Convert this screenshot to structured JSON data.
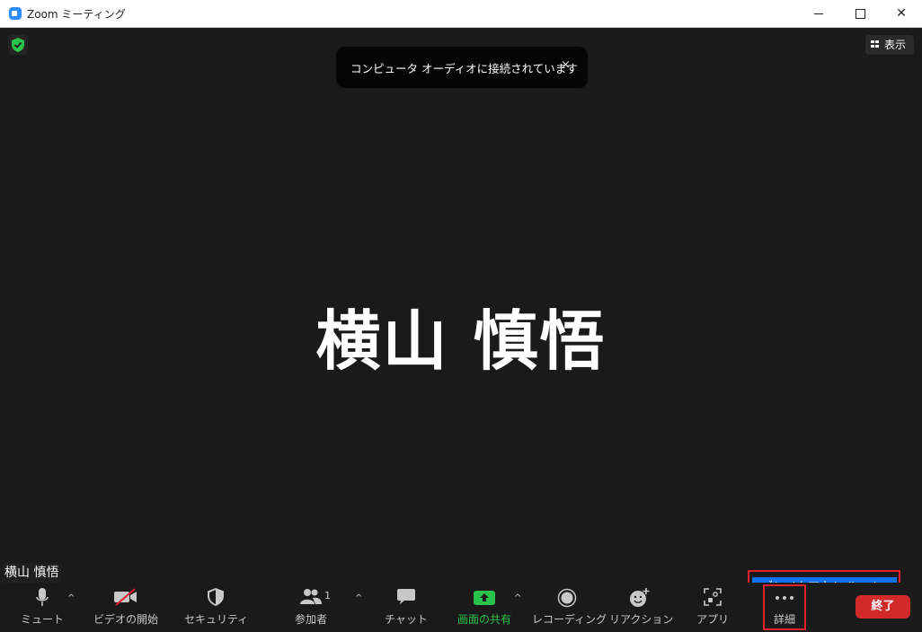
{
  "window": {
    "title": "Zoom ミーティング",
    "controls": {
      "minimize": "minimize",
      "maximize": "maximize",
      "close": "✕"
    }
  },
  "header": {
    "view_button": "表示"
  },
  "notification": {
    "message": "コンピュータ オーディオに接続されています",
    "close": "×"
  },
  "participant": {
    "display_name": "横山 慎悟",
    "name_tag": "横山 慎悟"
  },
  "popup_menu": {
    "items": [
      "ブレイクアウト ルーム"
    ]
  },
  "toolbar": {
    "mute": "ミュート",
    "video": "ビデオの開始",
    "security": "セキュリティ",
    "participants": "参加者",
    "participants_count": "1",
    "chat": "チャット",
    "share": "画面の共有",
    "record": "レコーディング",
    "reactions": "リアクション",
    "apps": "アプリ",
    "more": "詳細",
    "end": "終了",
    "caret": "^"
  },
  "colors": {
    "background": "#1a1a1a",
    "accent_blue": "#0e72ed",
    "share_green": "#29c24a",
    "end_red": "#d02a2a",
    "highlight_red": "#e0202c"
  }
}
